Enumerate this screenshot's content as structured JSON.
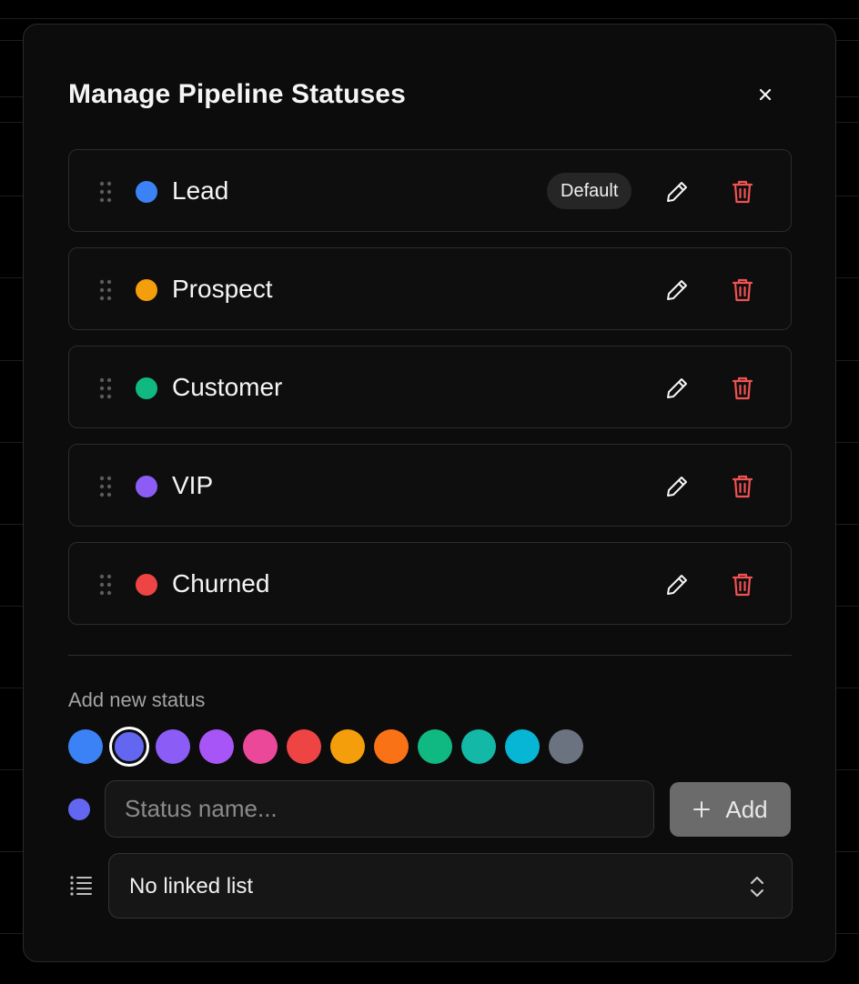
{
  "modal": {
    "title": "Manage Pipeline Statuses",
    "close_icon": "close-icon"
  },
  "statuses": [
    {
      "name": "Lead",
      "color": "#3b82f6",
      "badge": "Default"
    },
    {
      "name": "Prospect",
      "color": "#f59e0b",
      "badge": ""
    },
    {
      "name": "Customer",
      "color": "#10b981",
      "badge": ""
    },
    {
      "name": "VIP",
      "color": "#8b5cf6",
      "badge": ""
    },
    {
      "name": "Churned",
      "color": "#ef4444",
      "badge": ""
    }
  ],
  "row_icons": {
    "drag": "drag-handle-icon",
    "edit": "pencil-icon",
    "delete": "trash-icon"
  },
  "add_form": {
    "label": "Add new status",
    "swatches": [
      "#3b82f6",
      "#6366f1",
      "#8b5cf6",
      "#a855f7",
      "#ec4899",
      "#ef4444",
      "#f59e0b",
      "#f97316",
      "#10b981",
      "#14b8a6",
      "#06b6d4",
      "#6b7280"
    ],
    "selected_color": "#6366f1",
    "name_placeholder": "Status name...",
    "name_value": "",
    "add_label": "Add",
    "add_icon": "plus-icon",
    "list_icon": "list-icon",
    "list_select_value": "No linked list",
    "list_select_icon": "chevrons-up-down-icon"
  },
  "colors": {
    "background": "#000000",
    "modal": "#0c0c0c",
    "delete": "#f05252",
    "add_button": "#6b6b6b"
  }
}
